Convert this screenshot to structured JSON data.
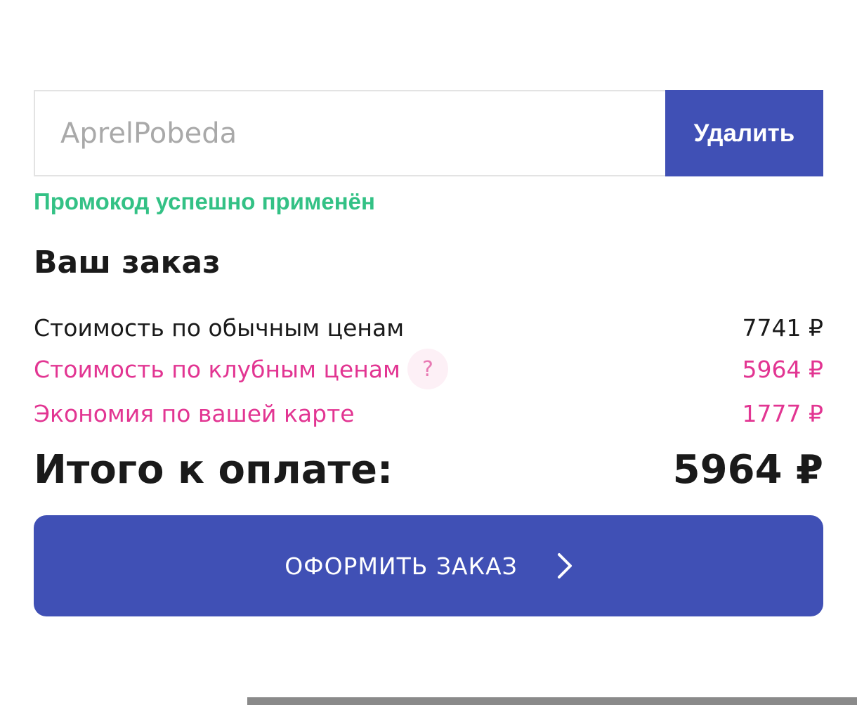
{
  "promo": {
    "code_value": "AprelPobeda",
    "delete_label": "Удалить",
    "status_message": "Промокод успешно применён",
    "status_color": "#33c185"
  },
  "order": {
    "title": "Ваш заказ",
    "regular_price_label": "Стоимость по обычным ценам",
    "regular_price_value": "7741 ₽",
    "club_price_label": "Стоимость по клубным ценам",
    "club_help_symbol": "?",
    "club_price_value": "5964 ₽",
    "savings_label": "Экономия по вашей карте",
    "savings_value": "1777 ₽",
    "total_label": "Итого к оплате:",
    "total_value": "5964 ₽"
  },
  "checkout": {
    "label": "ОФОРМИТЬ ЗАКАЗ",
    "icon": "chevron-right-icon"
  },
  "colors": {
    "accent": "#4050b5",
    "club_pink": "#e23592",
    "success_green": "#33c185"
  }
}
